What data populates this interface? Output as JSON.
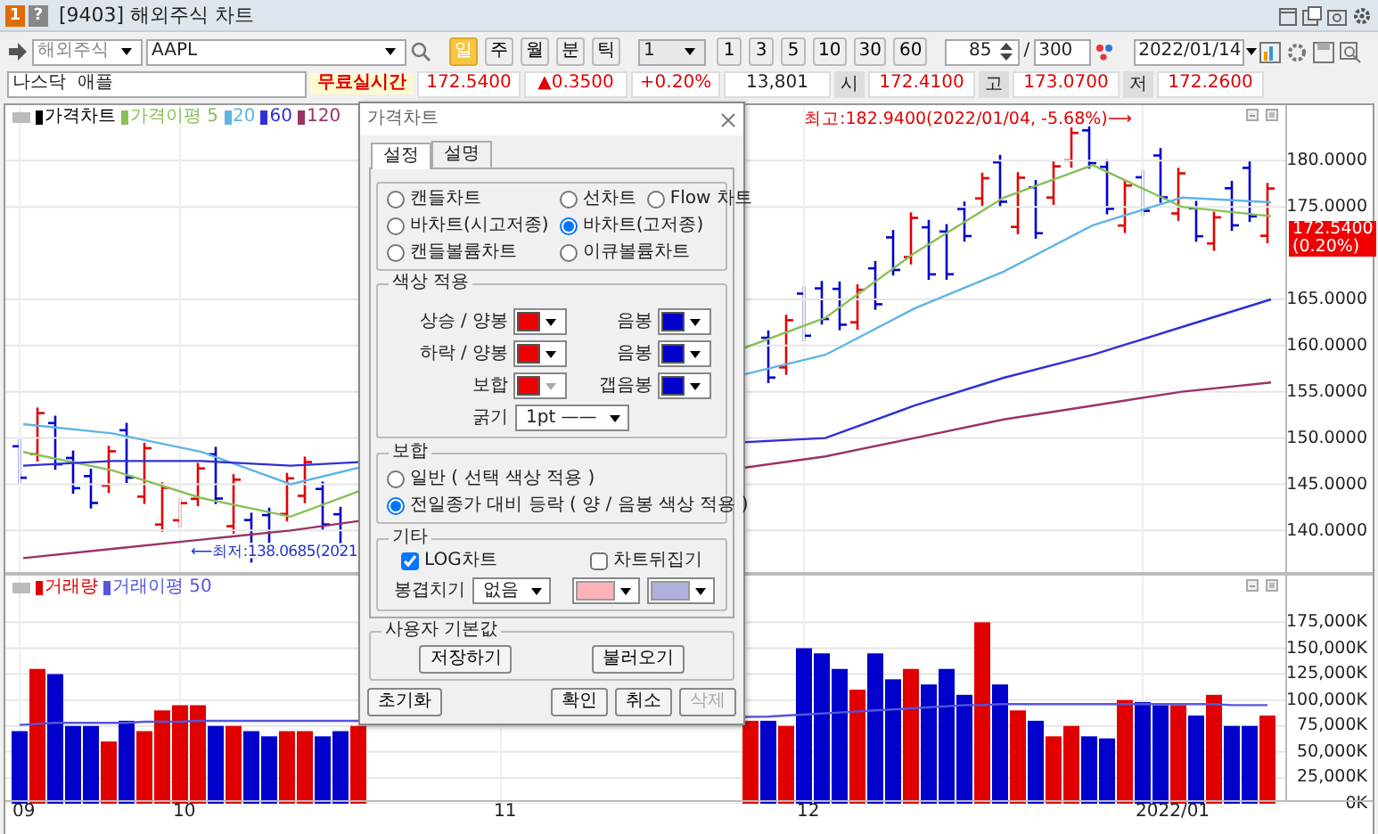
{
  "window": {
    "badges": [
      "1",
      "?"
    ],
    "title": "[9403] 해외주식 차트"
  },
  "toolbar": {
    "market": "해외주식",
    "symbol": "AAPL",
    "periods": [
      {
        "label": "일",
        "selected": true
      },
      {
        "label": "주",
        "selected": false
      },
      {
        "label": "월",
        "selected": false
      },
      {
        "label": "분",
        "selected": false
      },
      {
        "label": "틱",
        "selected": false
      }
    ],
    "unit": "1",
    "intervals": [
      "1",
      "3",
      "5",
      "10",
      "30",
      "60"
    ],
    "count": "85",
    "separator": "/",
    "total": "300",
    "date": "2022/01/14"
  },
  "quote": {
    "name": "나스닥  애플",
    "badge": "무료실시간",
    "price": "172.5400",
    "change": "▲0.3500",
    "rate": "+0.20%",
    "volume": "13,801",
    "fields": [
      {
        "label": "시",
        "value": "172.4100"
      },
      {
        "label": "고",
        "value": "173.0700"
      },
      {
        "label": "저",
        "value": "172.2600"
      }
    ]
  },
  "price_panel": {
    "legend": [
      {
        "label": "가격차트",
        "color": "#000000"
      }
    ],
    "price_tag": {
      "value": "172.5400",
      "rate": "(0.20%)"
    },
    "chart_data": {
      "type": "line",
      "grid": true,
      "legend": "upper left",
      "ylim": [
        135.5,
        186
      ],
      "yticks": [
        {
          "value": 140,
          "label": "140.0000"
        },
        {
          "value": 145,
          "label": "145.0000"
        },
        {
          "value": 150,
          "label": "150.0000"
        },
        {
          "value": 155,
          "label": "155.0000"
        },
        {
          "value": 160,
          "label": "160.0000"
        },
        {
          "value": 165,
          "label": "165.0000"
        },
        {
          "value": 175,
          "label": "175.0000"
        },
        {
          "value": 180,
          "label": "180.0000"
        }
      ],
      "series": [
        {
          "name": "가격이평 5",
          "color": "#88c057",
          "values": [
            148.5,
            146.5,
            143.5,
            141.5,
            null,
            null,
            null,
            null,
            null,
            163,
            170,
            176,
            179.5,
            175,
            174
          ]
        },
        {
          "name": "20",
          "color": "#5fb4e6",
          "values": [
            151.5,
            150.5,
            148.5,
            145,
            null,
            null,
            null,
            null,
            null,
            159,
            164,
            168,
            173,
            176,
            175.5
          ]
        },
        {
          "name": "60",
          "color": "#3030d8",
          "values": [
            147,
            147.5,
            147.5,
            147,
            null,
            null,
            null,
            null,
            null,
            150,
            153.5,
            156.5,
            159,
            162,
            165
          ]
        },
        {
          "name": "120",
          "color": "#993366",
          "values": [
            137,
            138,
            139,
            140,
            null,
            null,
            null,
            null,
            null,
            148,
            150,
            152,
            153.5,
            155,
            156
          ]
        }
      ],
      "annotations": [
        "최고:182.9400(2022/01/04, -5.68%)⟶",
        "⟵최저:138.0685(2021"
      ]
    }
  },
  "volume_panel": {
    "x_axis_labels": [
      "09",
      "10",
      "11",
      "12",
      "2022/01"
    ],
    "chart_data": {
      "type": "bar",
      "grid": true,
      "legend": "upper left",
      "ylim": [
        0,
        220000
      ],
      "yticks": [
        {
          "value": 0,
          "label": "0K"
        },
        {
          "value": 25000,
          "label": "25,000K"
        },
        {
          "value": 50000,
          "label": "50,000K"
        },
        {
          "value": 75000,
          "label": "75,000K"
        },
        {
          "value": 100000,
          "label": "100,000K"
        },
        {
          "value": 125000,
          "label": "125,000K"
        },
        {
          "value": 150000,
          "label": "150,000K"
        },
        {
          "value": 175000,
          "label": "175,000K"
        }
      ],
      "series": [
        {
          "name": "거래량",
          "color": "#e00000",
          "values": [
            null,
            130000,
            null,
            null,
            null,
            60000,
            null,
            70000,
            90000,
            95000,
            95000,
            null,
            75000,
            null,
            null,
            70000,
            70000,
            null,
            null,
            75000,
            null,
            null,
            null,
            null,
            null,
            null,
            null,
            null,
            null,
            null,
            null,
            null,
            null,
            null,
            null,
            null,
            null,
            null,
            null,
            null,
            null,
            80000,
            null,
            75000,
            null,
            null,
            null,
            110000,
            null,
            null,
            130000,
            null,
            null,
            null,
            175000,
            null,
            90000,
            null,
            65000,
            75000,
            null,
            null,
            100000,
            null,
            null,
            95000,
            null,
            105000,
            null,
            null,
            85000
          ]
        },
        {
          "color": "#0000cc",
          "values": [
            70000,
            null,
            125000,
            75000,
            75000,
            null,
            80000,
            null,
            null,
            null,
            null,
            75000,
            null,
            70000,
            65000,
            null,
            null,
            65000,
            70000,
            null,
            null,
            null,
            null,
            null,
            null,
            null,
            null,
            null,
            null,
            null,
            null,
            null,
            null,
            null,
            null,
            null,
            null,
            null,
            null,
            null,
            null,
            null,
            80000,
            null,
            150000,
            145000,
            130000,
            null,
            145000,
            120000,
            null,
            115000,
            130000,
            105000,
            null,
            115000,
            null,
            80000,
            null,
            null,
            65000,
            63000,
            null,
            98000,
            95000,
            null,
            85000,
            null,
            75000,
            75000,
            null
          ]
        },
        {
          "name": "거래이평 50",
          "color": "#5555dd",
          "type": "line",
          "values": [
            76000,
            77000,
            78000,
            78000,
            78000,
            78000,
            78000,
            79000,
            79000,
            79000,
            80000,
            80000,
            80000,
            80000,
            80000,
            80000,
            80000,
            80000,
            80000,
            80000,
            null,
            null,
            null,
            null,
            null,
            null,
            null,
            null,
            null,
            null,
            null,
            null,
            null,
            null,
            null,
            null,
            null,
            null,
            null,
            null,
            null,
            null,
            84000,
            85000,
            86000,
            87000,
            88000,
            89000,
            90000,
            91000,
            92000,
            93000,
            94000,
            95000,
            95000,
            96000,
            96000,
            96000,
            96000,
            96000,
            96000,
            96000,
            96000,
            96000,
            96000,
            96000,
            96000,
            96000,
            95000,
            95000,
            95000
          ]
        }
      ]
    }
  },
  "dialog": {
    "title": "가격차트",
    "tabs": [
      {
        "label": "설정",
        "selected": true
      },
      {
        "label": "설명",
        "selected": false
      }
    ],
    "chart_types": [
      {
        "label": "캔들차트",
        "selected": false
      },
      {
        "label": "선차트",
        "selected": false
      },
      {
        "label": "Flow 차트",
        "selected": false
      },
      {
        "label": "바차트(시고저종)",
        "selected": false
      },
      {
        "label": "바차트(고저종)",
        "selected": true
      },
      {
        "label": "캔들볼륨차트",
        "selected": false
      },
      {
        "label": "이큐볼륨차트",
        "selected": false
      }
    ],
    "color_group": {
      "title": "색상 적용",
      "swatches": [
        {
          "label": "상승 / 양봉",
          "color": "#ee0000",
          "disabled": false
        },
        {
          "label": "음봉",
          "color": "#0000cc",
          "disabled": false
        },
        {
          "label": "하락 / 양봉",
          "color": "#ee0000",
          "disabled": false
        },
        {
          "label": "음봉",
          "color": "#0000cc",
          "disabled": false
        },
        {
          "label": "보합",
          "color": "#ee0000",
          "disabled": true
        },
        {
          "label": "갭음봉",
          "color": "#0000cc",
          "disabled": false
        }
      ],
      "thickness": {
        "label": "굵기",
        "value": "1pt ——"
      }
    },
    "hold_group": {
      "title": "보합",
      "options": [
        {
          "label": "일반 ( 선택 색상 적용 )",
          "selected": false
        },
        {
          "label": "전일종가 대비 등락 ( 양 / 음봉 색상 적용 )",
          "selected": true
        }
      ]
    },
    "misc_group": {
      "title": "기타",
      "checks": [
        {
          "label": "LOG차트",
          "checked": true
        },
        {
          "label": "차트뒤집기",
          "checked": false
        }
      ],
      "overlap_label": "봉겹치기",
      "overlap_value": "없음",
      "colors": [
        {
          "color": "#ffb3b8"
        },
        {
          "color": "#b0b0dc"
        }
      ]
    },
    "defaults_group": {
      "title": "사용자 기본값",
      "buttons": [
        "저장하기",
        "불러오기"
      ]
    },
    "footer": [
      {
        "label": "초기화",
        "disabled": false
      },
      {
        "label": "확인",
        "disabled": false
      },
      {
        "label": "취소",
        "disabled": false
      },
      {
        "label": "삭제",
        "disabled": true
      }
    ]
  }
}
